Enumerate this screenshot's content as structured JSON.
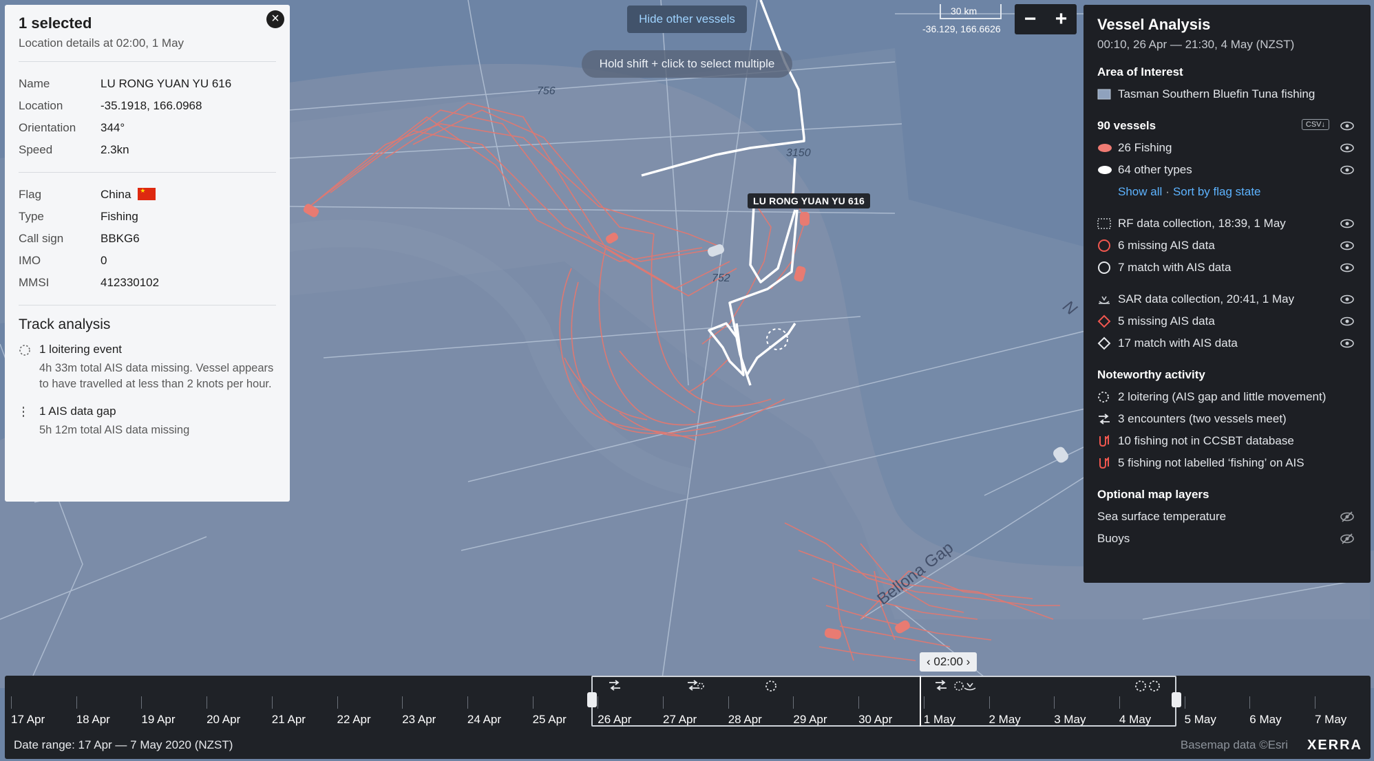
{
  "map": {
    "hide_vessels_label": "Hide other vessels",
    "shift_hint": "Hold shift + click to select multiple",
    "scale_label": "30 km",
    "coordinates": "-36.129, 166.6626",
    "zoom_out": "−",
    "zoom_in": "+",
    "vessel_label": "LU RONG YUAN YU 616",
    "depth_labels": [
      "756",
      "3150",
      "752"
    ],
    "feature_label": "Bellona Gap",
    "feature_label_2": "N",
    "colors": {
      "ocean": "#6f86a7",
      "fishing_track": "#e87b72",
      "selected_track": "#ffffff"
    }
  },
  "left_panel": {
    "title": "1 selected",
    "subtitle": "Location details at 02:00, 1 May",
    "details": [
      {
        "key": "Name",
        "value": "LU RONG YUAN YU 616"
      },
      {
        "key": "Location",
        "value": "-35.1918, 166.0968"
      },
      {
        "key": "Orientation",
        "value": "344°"
      },
      {
        "key": "Speed",
        "value": "2.3kn"
      }
    ],
    "vessel_info": [
      {
        "key": "Flag",
        "value": "China"
      },
      {
        "key": "Type",
        "value": "Fishing"
      },
      {
        "key": "Call sign",
        "value": "BBKG6"
      },
      {
        "key": "IMO",
        "value": "0"
      },
      {
        "key": "MMSI",
        "value": "412330102"
      }
    ],
    "track_heading": "Track analysis",
    "events": [
      {
        "icon": "loitering-icon",
        "title": "1 loitering event",
        "desc": "4h 33m total AIS data missing. Vessel appears to have travelled at less than 2 knots per hour."
      },
      {
        "icon": "ais-gap-icon",
        "title": "1 AIS data gap",
        "desc": "5h 12m total AIS data missing"
      }
    ]
  },
  "right_panel": {
    "title": "Vessel Analysis",
    "subtitle": "00:10, 26 Apr — 21:30, 4 May (NZST)",
    "aoi_heading": "Area of Interest",
    "aoi_name": "Tasman Southern Bluefin Tuna fishing",
    "vessels_heading": "90 vessels",
    "csv_label": "CSV↓",
    "fishing": "26 Fishing",
    "other_types": "64 other types",
    "show_all": "Show all",
    "sort_by_flag": "Sort by flag state",
    "rf_collection": "RF data collection, 18:39, 1 May",
    "rf_missing": "6 missing AIS data",
    "rf_match": "7 match with AIS data",
    "sar_collection": "SAR data collection, 20:41, 1 May",
    "sar_missing": "5 missing AIS data",
    "sar_match": "17 match with AIS data",
    "noteworthy_heading": "Noteworthy activity",
    "loitering": "2 loitering (AIS gap and little movement)",
    "encounters": "3 encounters (two vessels meet)",
    "not_ccsbt": "10 fishing not in CCSBT database",
    "not_labelled": "5 fishing not labelled ‘fishing’ on AIS",
    "layers_heading": "Optional map layers",
    "sst": "Sea surface temperature",
    "buoys": "Buoys"
  },
  "timeline": {
    "dates": [
      "17 Apr",
      "18 Apr",
      "19 Apr",
      "20 Apr",
      "21 Apr",
      "22 Apr",
      "23 Apr",
      "24 Apr",
      "25 Apr",
      "26 Apr",
      "27 Apr",
      "28 Apr",
      "29 Apr",
      "30 Apr",
      "1 May",
      "2 May",
      "3 May",
      "4 May",
      "5 May",
      "6 May",
      "7 May"
    ],
    "playhead": "‹ 02:00 ›",
    "date_range": "Date range: 17 Apr — 7 May 2020 (NZST)",
    "basemap": "Basemap data ©Esri",
    "logo": "XERRA"
  }
}
